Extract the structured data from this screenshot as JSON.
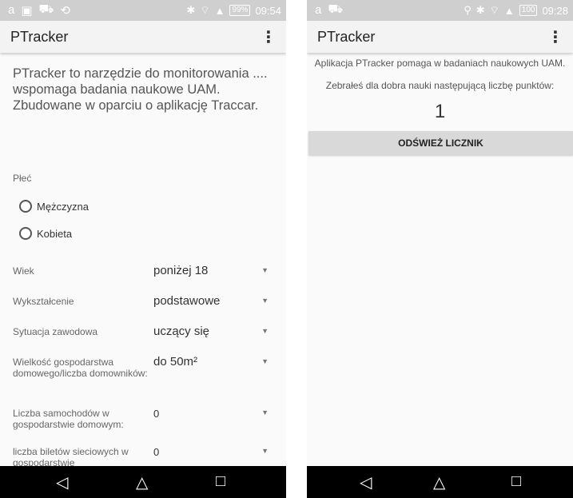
{
  "left": {
    "status": {
      "icons": [
        "a",
        "▣",
        "⛟",
        "⟲"
      ],
      "right_icons": [
        "✱",
        "⌔",
        "▲"
      ],
      "battery": "99%",
      "time": "09:54"
    },
    "app_title": "PTracker",
    "intro": "PTracker to narzędzie do monitorowania .... wspomaga badania naukowe UAM. Zbudowane w oparciu o aplikację Traccar.",
    "gender_label": "Płeć",
    "gender_options": [
      "Mężczyzna",
      "Kobieta"
    ],
    "fields": [
      {
        "label": "Wiek",
        "value": "poniżej 18"
      },
      {
        "label": "Wykształcenie",
        "value": "podstawowe"
      },
      {
        "label": "Sytuacja zawodowa",
        "value": "uczący się"
      },
      {
        "label": "Wielkość gospodarstwa domowego/liczba domowników:",
        "value": "do 50m²"
      },
      {
        "label": "Liczba samochodów w gospodarstwie domowym:",
        "value": "0"
      },
      {
        "label": "liczba biletów sieciowych w gospodarstwie",
        "value": "0"
      }
    ]
  },
  "right": {
    "status": {
      "battery": "100",
      "time": "09:28"
    },
    "app_title": "PTracker",
    "info": "Aplikacja PTracker pomaga w badaniach naukowych UAM.",
    "points_label": "Zebrałeś dla dobra nauki następującą liczbę punktów:",
    "points": "1",
    "refresh_label": "ODŚWIEŻ LICZNIK"
  },
  "nav": {
    "back": "◁",
    "home": "△",
    "recent": "□"
  }
}
